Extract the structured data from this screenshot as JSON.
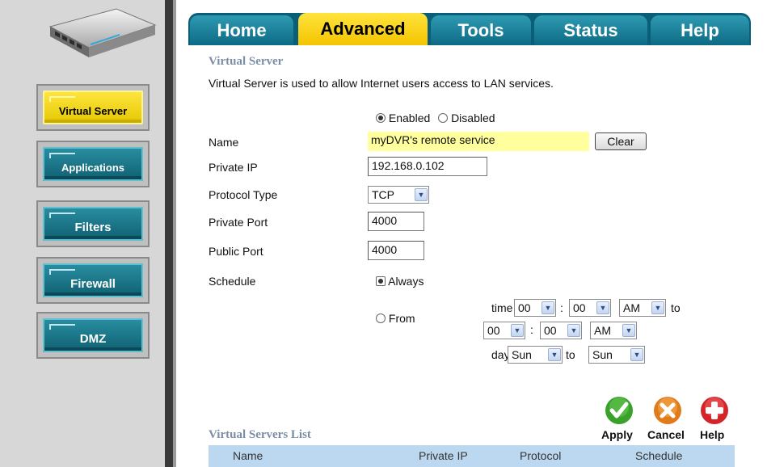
{
  "sidebar": {
    "items": [
      {
        "label": "Virtual Server",
        "active": true
      },
      {
        "label": "Applications",
        "active": false
      },
      {
        "label": "Filters",
        "active": false
      },
      {
        "label": "Firewall",
        "active": false
      },
      {
        "label": "DMZ",
        "active": false
      }
    ]
  },
  "tabs": [
    {
      "label": "Home",
      "active": false
    },
    {
      "label": "Advanced",
      "active": true
    },
    {
      "label": "Tools",
      "active": false
    },
    {
      "label": "Status",
      "active": false
    },
    {
      "label": "Help",
      "active": false
    }
  ],
  "section": {
    "title": "Virtual Server",
    "description": "Virtual Server is used to allow Internet users access to LAN services."
  },
  "form": {
    "enabled_label": "Enabled",
    "disabled_label": "Disabled",
    "enabled_selected": true,
    "name_label": "Name",
    "name_value": "myDVR's remote service",
    "clear_label": "Clear",
    "private_ip_label": "Private IP",
    "private_ip_value": "192.168.0.102",
    "protocol_label": "Protocol Type",
    "protocol_value": "TCP",
    "private_port_label": "Private Port",
    "private_port_value": "4000",
    "public_port_label": "Public Port",
    "public_port_value": "4000",
    "schedule_label": "Schedule",
    "always_label": "Always",
    "from_label": "From",
    "time_label": "time",
    "start_hour": "00",
    "start_min": "00",
    "start_ampm": "AM",
    "to_label": "to",
    "colon": ":",
    "end_hour": "00",
    "end_min": "00",
    "end_ampm": "AM",
    "day_label": "day",
    "day_start": "Sun",
    "day_end": "Sun"
  },
  "actions": {
    "apply_label": "Apply",
    "cancel_label": "Cancel",
    "help_label": "Help",
    "colors": {
      "apply": "#3aa12a",
      "cancel": "#e07a1a",
      "help": "#d4242a"
    }
  },
  "list": {
    "title": "Virtual Servers List",
    "columns": [
      "Name",
      "Private IP",
      "Protocol",
      "Schedule"
    ]
  },
  "colors": {
    "tab_bar": "#0a5e77",
    "active_yellow": "#ffe33d",
    "nav_teal": "#1a7d91",
    "section_title": "#7c8ea6",
    "list_header": "#bcd8f0"
  }
}
